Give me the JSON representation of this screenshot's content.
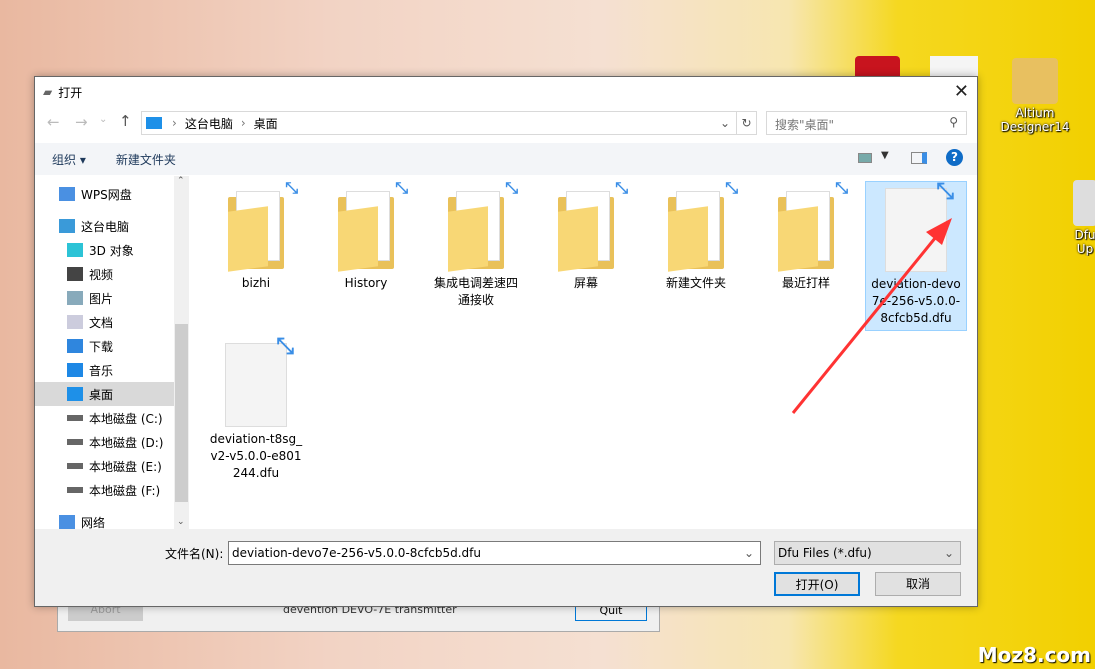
{
  "desktop": {
    "icons": [
      {
        "label": "Altium Designer14"
      },
      {
        "label": "Dfu Up"
      }
    ],
    "watermark": "Moz8.com"
  },
  "background_window": {
    "abort": "Abort",
    "caption": "devention DEVO-7E transmitter",
    "quit": "Quit"
  },
  "dialog": {
    "title": "打开",
    "close_icon": "close-icon",
    "breadcrumb": [
      "这台电脑",
      "桌面"
    ],
    "search_placeholder": "搜索\"桌面\"",
    "toolbar": {
      "organize": "组织",
      "new_folder": "新建文件夹"
    },
    "sidebar": [
      {
        "label": "WPS网盘",
        "icon": "cloud-icon",
        "level": 0
      },
      {
        "label": "这台电脑",
        "icon": "computer-icon",
        "level": 0
      },
      {
        "label": "3D 对象",
        "icon": "cube-icon",
        "level": 1
      },
      {
        "label": "视频",
        "icon": "video-icon",
        "level": 1
      },
      {
        "label": "图片",
        "icon": "picture-icon",
        "level": 1
      },
      {
        "label": "文档",
        "icon": "document-icon",
        "level": 1
      },
      {
        "label": "下载",
        "icon": "download-icon",
        "level": 1
      },
      {
        "label": "音乐",
        "icon": "music-icon",
        "level": 1
      },
      {
        "label": "桌面",
        "icon": "desktop-icon",
        "level": 1,
        "selected": true
      },
      {
        "label": "本地磁盘 (C:)",
        "icon": "drive-icon",
        "level": 1
      },
      {
        "label": "本地磁盘 (D:)",
        "icon": "drive-icon",
        "level": 1
      },
      {
        "label": "本地磁盘 (E:)",
        "icon": "drive-icon",
        "level": 1
      },
      {
        "label": "本地磁盘 (F:)",
        "icon": "drive-icon",
        "level": 1
      },
      {
        "label": "网络",
        "icon": "network-icon",
        "level": 0
      }
    ],
    "files": [
      {
        "name": "bizhi",
        "type": "folder"
      },
      {
        "name": "History",
        "type": "folder"
      },
      {
        "name": "集成电调差速四通接收",
        "type": "folder"
      },
      {
        "name": "屏幕",
        "type": "folder"
      },
      {
        "name": "新建文件夹",
        "type": "folder"
      },
      {
        "name": "最近打样",
        "type": "folder"
      },
      {
        "name": "deviation-devo7e-256-v5.0.0-8cfcb5d.dfu",
        "type": "file",
        "selected": true
      },
      {
        "name": "deviation-t8sg_v2-v5.0.0-e801244.dfu",
        "type": "file"
      }
    ],
    "filename_label": "文件名(N):",
    "filename_value": "deviation-devo7e-256-v5.0.0-8cfcb5d.dfu",
    "filetype_value": "Dfu Files (*.dfu)",
    "open_button": "打开(O)",
    "cancel_button": "取消",
    "colors": {
      "accent": "#0078d7",
      "selection": "#cce8ff",
      "annotation_arrow": "#ff3333"
    }
  }
}
